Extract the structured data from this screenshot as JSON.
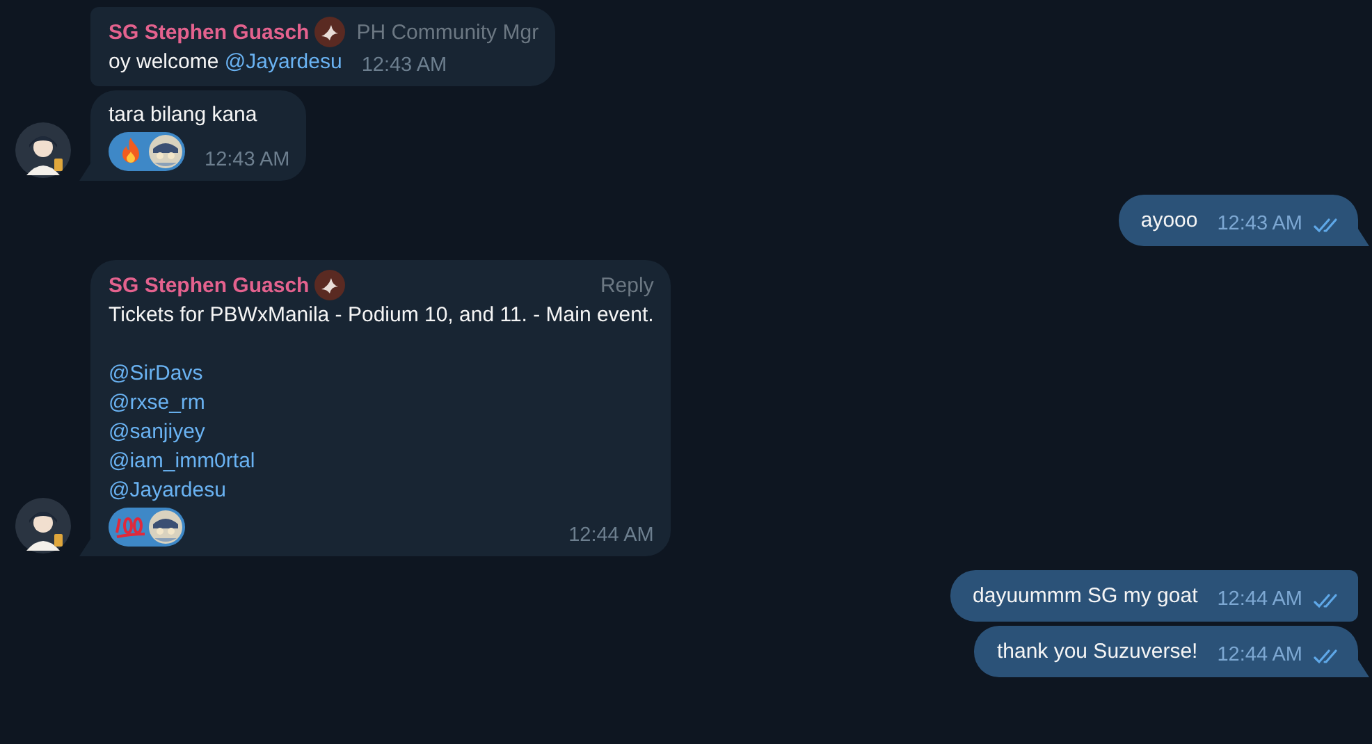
{
  "messages": [
    {
      "outgoing": false,
      "sender": "SG Stephen Guasch",
      "role": "PH Community Mgr",
      "paragraphs": [
        [
          [
            {
              "kind": "text",
              "text": "oy welcome "
            },
            {
              "kind": "mention",
              "text": "@Jayardesu"
            }
          ]
        ]
      ],
      "time": "12:43 AM"
    },
    {
      "outgoing": false,
      "paragraphs": [
        [
          [
            {
              "kind": "text",
              "text": "tara bilang kana"
            }
          ]
        ]
      ],
      "reactions": [
        {
          "kind": "fire"
        },
        {
          "kind": "sticker"
        }
      ],
      "time": "12:43 AM"
    },
    {
      "outgoing": true,
      "paragraphs": [
        [
          [
            {
              "kind": "text",
              "text": "ayooo"
            }
          ]
        ]
      ],
      "time": "12:43 AM",
      "read": true
    },
    {
      "outgoing": false,
      "sender": "SG Stephen Guasch",
      "reply_label": "Reply",
      "paragraphs": [
        [
          [
            {
              "kind": "text",
              "text": "Tickets for PBWxManila - Podium 10, and 11. - Main event."
            }
          ]
        ],
        [
          [
            {
              "kind": "mention",
              "text": "@SirDavs"
            }
          ],
          [
            {
              "kind": "mention",
              "text": "@rxse_rm"
            }
          ],
          [
            {
              "kind": "mention",
              "text": "@sanjiyey"
            }
          ],
          [
            {
              "kind": "mention",
              "text": "@iam_imm0rtal"
            }
          ],
          [
            {
              "kind": "mention",
              "text": "@Jayardesu"
            }
          ]
        ]
      ],
      "reactions": [
        {
          "kind": "hundred"
        },
        {
          "kind": "sticker"
        }
      ],
      "time": "12:44 AM"
    },
    {
      "outgoing": true,
      "paragraphs": [
        [
          [
            {
              "kind": "text",
              "text": "dayuummm SG my goat"
            }
          ]
        ]
      ],
      "time": "12:44 AM",
      "read": true
    },
    {
      "outgoing": true,
      "paragraphs": [
        [
          [
            {
              "kind": "text",
              "text": "thank you Suzuverse!"
            }
          ]
        ]
      ],
      "time": "12:44 AM",
      "read": true
    }
  ]
}
